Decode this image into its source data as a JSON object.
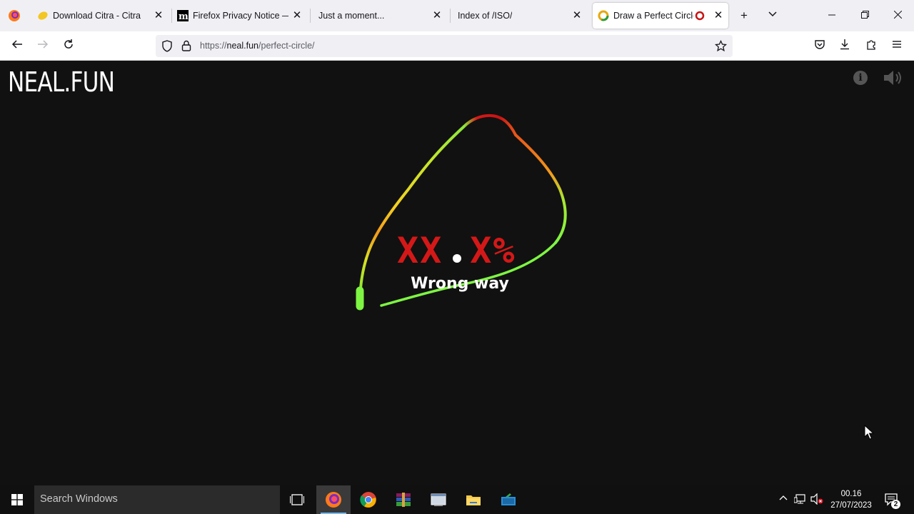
{
  "browser": {
    "tabs": [
      {
        "title": "Download Citra - Citra",
        "favicon": "citra-lemon-icon",
        "active": false
      },
      {
        "title": "Firefox Privacy Notice — M",
        "favicon": "mozilla-m-icon",
        "active": false
      },
      {
        "title": "Just a moment...",
        "favicon": "none",
        "active": false
      },
      {
        "title": "Index of /ISO/",
        "favicon": "none",
        "active": false
      },
      {
        "title": "Draw a Perfect Circle",
        "favicon": "perfect-circle-icon",
        "active": true
      }
    ],
    "url": {
      "prefix": "https://",
      "host": "neal.fun",
      "path": "/perfect-circle/"
    }
  },
  "page": {
    "logo": "NEAL.FUN",
    "score_left": "XX",
    "score_right": "X%",
    "message": "Wrong way",
    "colors": {
      "background": "#111111",
      "score": "#d41818",
      "good": "#7ef542",
      "bad": "#c81414"
    }
  },
  "taskbar": {
    "search_placeholder": "Search Windows",
    "time": "00.16",
    "date": "27/07/2023",
    "notification_count": "2"
  }
}
